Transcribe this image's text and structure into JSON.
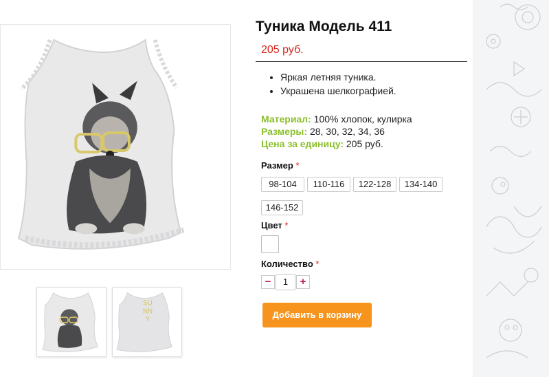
{
  "product": {
    "title": "Туника Модель 411",
    "price": "205 руб.",
    "features": [
      "Яркая летняя туника.",
      "Украшена шелкографией."
    ],
    "specs": [
      {
        "label": "Материал:",
        "value": "100% хлопок, кулирка"
      },
      {
        "label": "Размеры:",
        "value": "28, 30, 32, 34, 36"
      },
      {
        "label": "Цена за единицу:",
        "value": "205 руб."
      }
    ]
  },
  "options": {
    "size_label": "Размер",
    "sizes": [
      "98-104",
      "110-116",
      "122-128",
      "134-140",
      "146-152"
    ],
    "color_label": "Цвет",
    "quantity_label": "Количество",
    "required_mark": "*",
    "quantity_value": "1",
    "minus": "−",
    "plus": "+"
  },
  "cart": {
    "button_label": "Добавить в корзину"
  },
  "images": {
    "back_print_text": [
      "SU",
      "NN",
      "Y"
    ]
  },
  "colors": {
    "accent": "#f7941d",
    "price": "#d9251d",
    "spec_label": "#8cbf2c",
    "qty_sign": "#c2185b"
  }
}
